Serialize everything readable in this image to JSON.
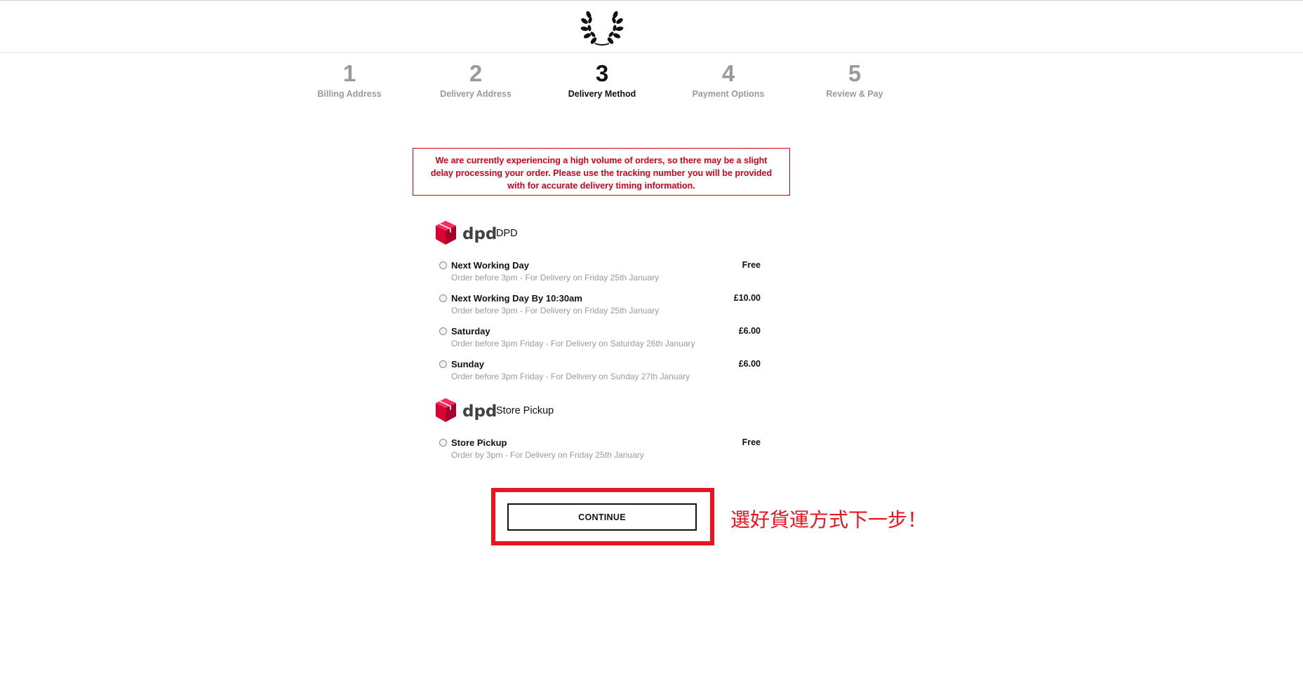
{
  "steps": [
    {
      "number": "1",
      "label": "Billing Address",
      "active": false
    },
    {
      "number": "2",
      "label": "Delivery Address",
      "active": false
    },
    {
      "number": "3",
      "label": "Delivery Method",
      "active": true
    },
    {
      "number": "4",
      "label": "Payment Options",
      "active": false
    },
    {
      "number": "5",
      "label": "Review & Pay",
      "active": false
    }
  ],
  "notice": {
    "text": "We are currently experiencing a high volume of orders, so there may be a slight delay processing your order. Please use the tracking number you will be provided with for accurate delivery timing information."
  },
  "carriers": [
    {
      "logo_text": "dpd",
      "name": "DPD",
      "options": [
        {
          "title": "Next Working Day",
          "subtitle": "Order before 3pm - For Delivery on Friday 25th January",
          "price": "Free"
        },
        {
          "title": "Next Working Day By 10:30am",
          "subtitle": "Order before 3pm - For Delivery on Friday 25th January",
          "price": "£10.00"
        },
        {
          "title": "Saturday",
          "subtitle": "Order before 3pm Friday - For Delivery on Saturday 26th January",
          "price": "£6.00"
        },
        {
          "title": "Sunday",
          "subtitle": "Order before 3pm Friday - For Delivery on Sunday 27th January",
          "price": "£6.00"
        }
      ]
    },
    {
      "logo_text": "dpd",
      "name": "Store Pickup",
      "options": [
        {
          "title": "Store Pickup",
          "subtitle": "Order by 3pm - For Delivery on Friday 25th January",
          "price": "Free"
        }
      ]
    }
  ],
  "continue_label": "CONTINUE",
  "annotation": "選好貨運方式下一步！",
  "colors": {
    "accent_red": "#d0021b",
    "highlight_red": "#e8141f",
    "dpd_red": "#dc0032",
    "muted_text": "#9a9a9a"
  },
  "icons": {
    "logo": "laurel-wreath-icon",
    "carrier": "dpd-cube-icon",
    "radio": "radio-unchecked-icon"
  }
}
